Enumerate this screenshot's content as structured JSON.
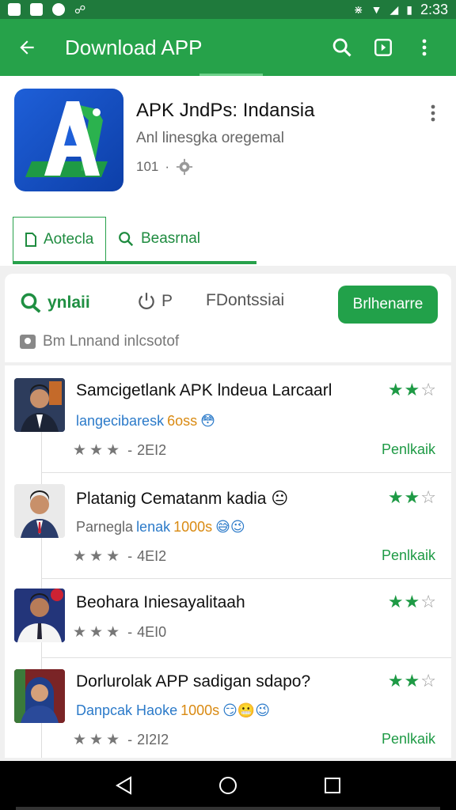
{
  "status": {
    "time": "2:33"
  },
  "appbar": {
    "title": "Download APP"
  },
  "app": {
    "name": "APK JndPs: Indansia",
    "subtitle": "Anl linesgka oregemal",
    "meta": "101"
  },
  "tabs": [
    {
      "label": "Aotecla"
    },
    {
      "label": "Beasrnal"
    }
  ],
  "filters": {
    "first": "ynlaii",
    "second": "P",
    "third": "FDontssiai",
    "button": "Brlhenarre",
    "note": "Bm Lnnand inlcsotof"
  },
  "rows": [
    {
      "title": "Samcigetlank APK lndeua Larcaarl",
      "subtitle_blue": "langecibaresk",
      "subtitle_orange": "6oss",
      "emoji": "😳",
      "count": "2EI2",
      "link": "Penlkaik"
    },
    {
      "title": "Platanig Cematanm kadia",
      "title_emoji": "😐",
      "subtitle_gray": "Parnegla",
      "subtitle_blue": "lenak",
      "subtitle_orange": "1000s",
      "emoji": "😅😉",
      "count": "4EI2",
      "link": "Penlkaik"
    },
    {
      "title": "Beohara Iniesayalitaah",
      "count": "4EI0"
    },
    {
      "title": "Dorlurolak APP sadigan sdapo?",
      "subtitle_blue": "Danpcak Haoke",
      "subtitle_orange": "1000s",
      "emoji": "😏😬😉",
      "count": "2I2I2",
      "link": "Penlkaik"
    }
  ],
  "colors": {
    "primary": "#26a24a",
    "statusbar": "#1f7a3c",
    "accent_link": "#1e9a45"
  }
}
